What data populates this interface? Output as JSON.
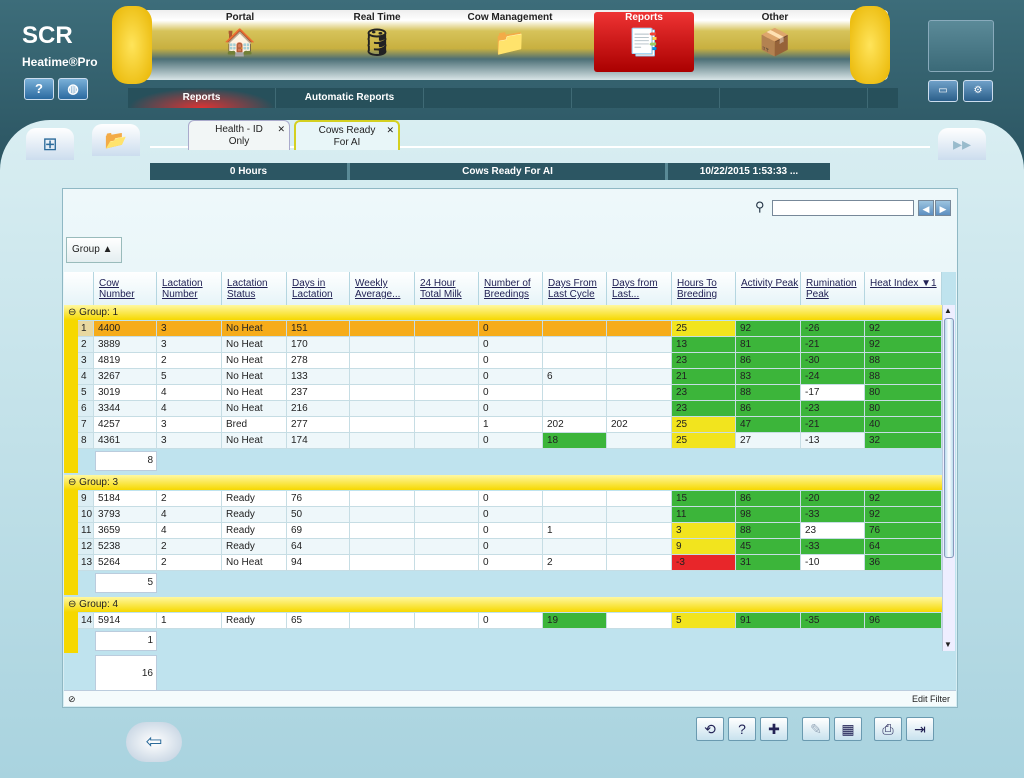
{
  "app": {
    "brand": "SCR",
    "product": "Heatime®Pro"
  },
  "nav": [
    {
      "label": "Portal",
      "icon": "barn-icon"
    },
    {
      "label": "Real Time",
      "icon": "tank-icon"
    },
    {
      "label": "Cow Management",
      "icon": "folder-icon"
    },
    {
      "label": "Reports",
      "icon": "reports-icon",
      "active": true
    },
    {
      "label": "Other",
      "icon": "box-icon"
    }
  ],
  "subnav": [
    "Reports",
    "Automatic Reports",
    "",
    "",
    ""
  ],
  "tabs": [
    {
      "label1": "Health - ID",
      "label2": "Only"
    },
    {
      "label1": "Cows Ready",
      "label2": "For AI",
      "active": true
    }
  ],
  "infobar": {
    "period": "0 Hours",
    "report": "Cows Ready For AI",
    "datetime": "10/22/2015 1:53:33 ..."
  },
  "search": {
    "value": "",
    "placeholder": ""
  },
  "groupby": {
    "label": "Group",
    "arrow": "▲"
  },
  "columns": [
    "Cow Number",
    "Lactation Number",
    "Lactation Status",
    "Days in Lactation",
    "Weekly Average...",
    "24 Hour Total Milk",
    "Number of Breedings",
    "Days From Last Cycle",
    "Days from Last...",
    "Hours To Breeding",
    "Activity Peak",
    "Rumination Peak",
    "Heat Index ▼1"
  ],
  "colors": {
    "g": "#3cb53a",
    "y": "#f2e41e",
    "r": "#e8262a",
    "highlight": "#f6ac1a"
  },
  "groups": [
    {
      "label": "Group: 1",
      "count": "8",
      "rows": [
        {
          "n": "1",
          "c": [
            "4400",
            "3",
            "No Heat",
            "151",
            "",
            "",
            "0",
            "",
            "",
            "25",
            "92",
            "-26",
            "92"
          ],
          "hl": [
            "",
            "",
            "",
            "",
            "",
            "",
            "",
            "",
            "",
            "y",
            "g",
            "g",
            "g"
          ],
          "selected": true
        },
        {
          "n": "2",
          "c": [
            "3889",
            "3",
            "No Heat",
            "170",
            "",
            "",
            "0",
            "",
            "",
            "13",
            "81",
            "-21",
            "92"
          ],
          "hl": [
            "",
            "",
            "",
            "",
            "",
            "",
            "",
            "",
            "",
            "g",
            "g",
            "g",
            "g"
          ]
        },
        {
          "n": "3",
          "c": [
            "4819",
            "2",
            "No Heat",
            "278",
            "",
            "",
            "0",
            "",
            "",
            "23",
            "86",
            "-30",
            "88"
          ],
          "hl": [
            "",
            "",
            "",
            "",
            "",
            "",
            "",
            "",
            "",
            "g",
            "g",
            "g",
            "g"
          ]
        },
        {
          "n": "4",
          "c": [
            "3267",
            "5",
            "No Heat",
            "133",
            "",
            "",
            "0",
            "6",
            "",
            "21",
            "83",
            "-24",
            "88"
          ],
          "hl": [
            "",
            "",
            "",
            "",
            "",
            "",
            "",
            "",
            "",
            "g",
            "g",
            "g",
            "g"
          ]
        },
        {
          "n": "5",
          "c": [
            "3019",
            "4",
            "No Heat",
            "237",
            "",
            "",
            "0",
            "",
            "",
            "23",
            "88",
            "-17",
            "80"
          ],
          "hl": [
            "",
            "",
            "",
            "",
            "",
            "",
            "",
            "",
            "",
            "g",
            "g",
            "",
            "g"
          ]
        },
        {
          "n": "6",
          "c": [
            "3344",
            "4",
            "No Heat",
            "216",
            "",
            "",
            "0",
            "",
            "",
            "23",
            "86",
            "-23",
            "80"
          ],
          "hl": [
            "",
            "",
            "",
            "",
            "",
            "",
            "",
            "",
            "",
            "g",
            "g",
            "g",
            "g"
          ]
        },
        {
          "n": "7",
          "c": [
            "4257",
            "3",
            "Bred",
            "277",
            "",
            "",
            "1",
            "202",
            "202",
            "25",
            "47",
            "-21",
            "40"
          ],
          "hl": [
            "",
            "",
            "",
            "",
            "",
            "",
            "",
            "",
            "",
            "y",
            "g",
            "g",
            "g"
          ]
        },
        {
          "n": "8",
          "c": [
            "4361",
            "3",
            "No Heat",
            "174",
            "",
            "",
            "0",
            "18",
            "",
            "25",
            "27",
            "-13",
            "32"
          ],
          "hl": [
            "",
            "",
            "",
            "",
            "",
            "",
            "",
            "g",
            "",
            "y",
            "",
            "",
            "g"
          ]
        }
      ]
    },
    {
      "label": "Group: 3",
      "count": "5",
      "rows": [
        {
          "n": "9",
          "c": [
            "5184",
            "2",
            "Ready",
            "76",
            "",
            "",
            "0",
            "",
            "",
            "15",
            "86",
            "-20",
            "92"
          ],
          "hl": [
            "",
            "",
            "",
            "",
            "",
            "",
            "",
            "",
            "",
            "g",
            "g",
            "g",
            "g"
          ]
        },
        {
          "n": "10",
          "c": [
            "3793",
            "4",
            "Ready",
            "50",
            "",
            "",
            "0",
            "",
            "",
            "11",
            "98",
            "-33",
            "92"
          ],
          "hl": [
            "",
            "",
            "",
            "",
            "",
            "",
            "",
            "",
            "",
            "g",
            "g",
            "g",
            "g"
          ]
        },
        {
          "n": "11",
          "c": [
            "3659",
            "4",
            "Ready",
            "69",
            "",
            "",
            "0",
            "1",
            "",
            "3",
            "88",
            "23",
            "76"
          ],
          "hl": [
            "",
            "",
            "",
            "",
            "",
            "",
            "",
            "",
            "",
            "y",
            "g",
            "",
            "g"
          ]
        },
        {
          "n": "12",
          "c": [
            "5238",
            "2",
            "Ready",
            "64",
            "",
            "",
            "0",
            "",
            "",
            "9",
            "45",
            "-33",
            "64"
          ],
          "hl": [
            "",
            "",
            "",
            "",
            "",
            "",
            "",
            "",
            "",
            "y",
            "g",
            "g",
            "g"
          ]
        },
        {
          "n": "13",
          "c": [
            "5264",
            "2",
            "No Heat",
            "94",
            "",
            "",
            "0",
            "2",
            "",
            "-3",
            "31",
            "-10",
            "36"
          ],
          "hl": [
            "",
            "",
            "",
            "",
            "",
            "",
            "",
            "",
            "",
            "r",
            "g",
            "",
            "g"
          ]
        }
      ]
    },
    {
      "label": "Group: 4",
      "count": "1",
      "rows": [
        {
          "n": "14",
          "c": [
            "5914",
            "1",
            "Ready",
            "65",
            "",
            "",
            "0",
            "19",
            "",
            "5",
            "91",
            "-35",
            "96"
          ],
          "hl": [
            "",
            "",
            "",
            "",
            "",
            "",
            "",
            "g",
            "",
            "y",
            "g",
            "g",
            "g"
          ]
        }
      ]
    }
  ],
  "total": "16",
  "footer": {
    "edit_filter": "Edit Filter"
  }
}
